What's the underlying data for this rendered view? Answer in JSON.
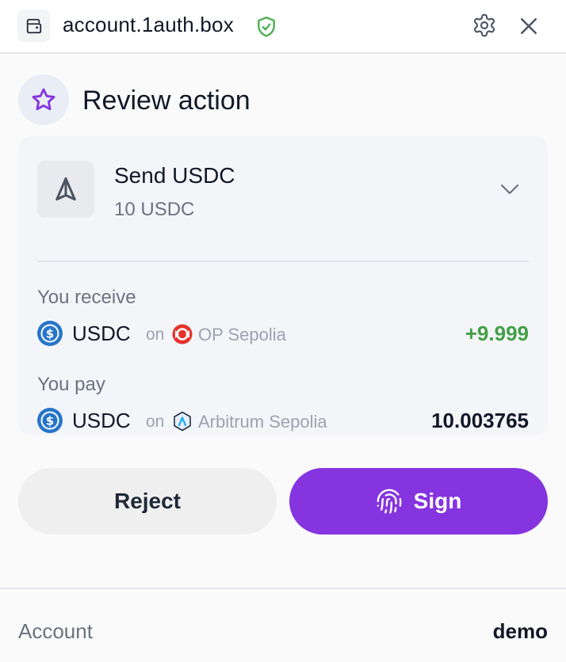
{
  "header": {
    "domain": "account.1auth.box",
    "icons": [
      "wallet-icon",
      "shield-check-icon",
      "gear-icon",
      "close-icon"
    ],
    "verified_color": "#4caf50"
  },
  "review": {
    "title": "Review action",
    "icon": "star-icon",
    "accent": "#8534e0"
  },
  "action": {
    "title": "Send USDC",
    "subtitle": "10 USDC",
    "icon": "send-icon",
    "expand_icon": "chevron-down-icon"
  },
  "receive": {
    "label": "You receive",
    "token": "USDC",
    "on": "on",
    "chain": "OP Sepolia",
    "amount": "+9.999",
    "amount_color": "#43a047"
  },
  "pay": {
    "label": "You pay",
    "token": "USDC",
    "on": "on",
    "chain": "Arbitrum Sepolia",
    "amount": "10.003765"
  },
  "buttons": {
    "reject": "Reject",
    "sign": "Sign"
  },
  "footer": {
    "label": "Account",
    "value": "demo"
  }
}
